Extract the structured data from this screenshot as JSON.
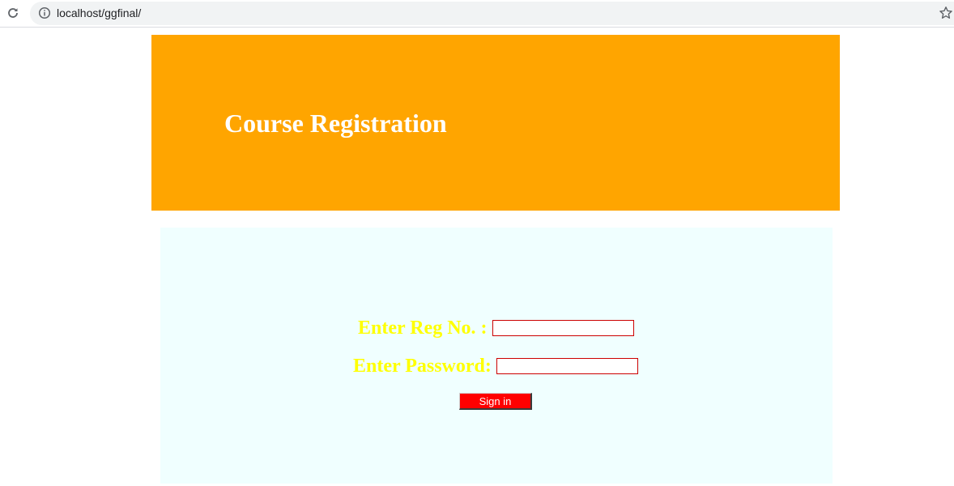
{
  "browser": {
    "url": "localhost/ggfinal/",
    "icons": {
      "reload": "reload-icon",
      "info": "info-icon",
      "bookmark": "star-icon"
    }
  },
  "header": {
    "title": "Course Registration",
    "background_color": "#ffa500",
    "title_color": "#ffffff"
  },
  "login": {
    "background_color": "#f0ffff",
    "label_color": "#ffff00",
    "reg_label": "Enter Reg No. :",
    "reg_value": "",
    "password_label": "Enter Password:",
    "password_value": "",
    "signin_label": "Sign in",
    "signin_color": "#ff0000"
  }
}
